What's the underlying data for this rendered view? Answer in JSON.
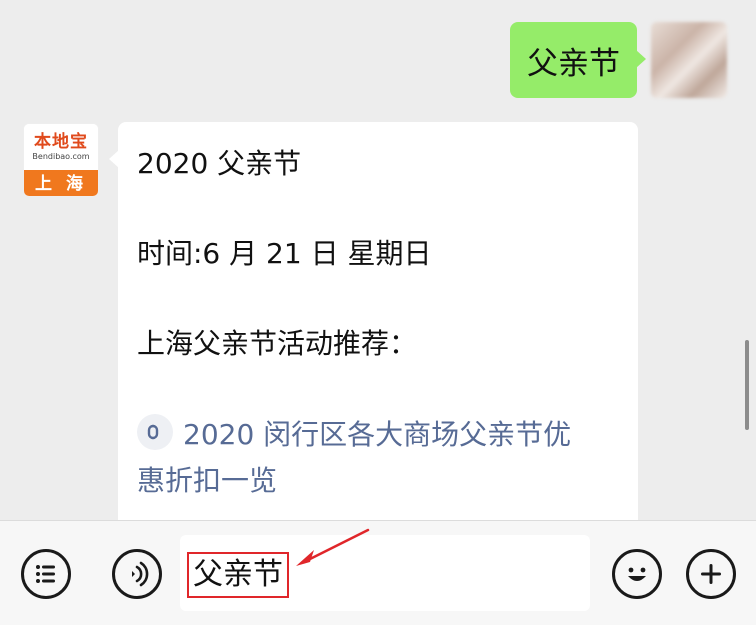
{
  "chat": {
    "outgoing_message": "父亲节",
    "logo": {
      "main": "本地宝",
      "sub": "Bendibao.com",
      "city": "上 海"
    },
    "incoming": {
      "line1": "2020 父亲节",
      "line2": "时间:6 月 21 日 星期日",
      "line3": "上海父亲节活动推荐：",
      "link_line1": "2020 闵行区各大商场父亲节优",
      "link_line2": "惠折扣一览"
    }
  },
  "input_bar": {
    "text": "父亲节"
  },
  "colors": {
    "outgoing_bubble": "#95ec69",
    "link": "#576b95",
    "annotation": "#e0262a",
    "logo_orange": "#f0781e"
  },
  "icons": [
    "menu-icon",
    "voice-icon",
    "emoji-icon",
    "plus-icon",
    "mini-program-link-icon",
    "annotation-arrow-icon"
  ]
}
